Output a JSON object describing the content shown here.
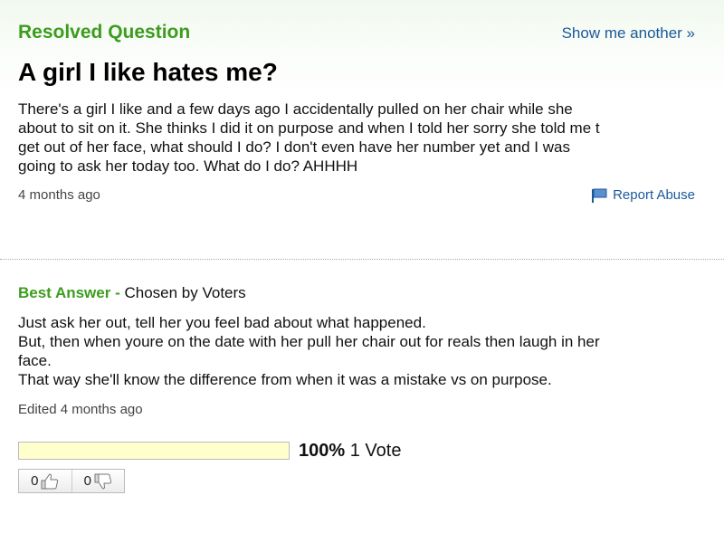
{
  "question": {
    "status_label": "Resolved Question",
    "show_another_label": "Show me another »",
    "title": "A girl I like hates me?",
    "body_lines": [
      "There's a girl I like and a few days ago I accidentally pulled on her chair while she",
      "about to sit on it. She thinks I did it on purpose and when I told her sorry she told me t",
      "get out of her face, what should I do? I don't even have her number yet and I was",
      "going to ask her today too. What do I do? AHHHH"
    ],
    "asked_time": "4 months ago",
    "report_abuse_label": "Report Abuse",
    "report_icon": "flag-icon"
  },
  "best_answer": {
    "label": "Best Answer",
    "separator": " - ",
    "chosen_by": "Chosen by Voters",
    "body_lines": [
      "Just ask her out, tell her you feel bad about what happened.",
      "But, then when youre on the date with her pull her chair out for reals then laugh in her",
      "face.",
      "That way she'll know the difference from when it was a mistake vs on purpose."
    ],
    "edited_time": "Edited 4 months ago"
  },
  "votes": {
    "fill_fraction": 1.0,
    "percent_label": "100%",
    "count_label": "1 Vote"
  },
  "ratings": {
    "thumbs_up_count": "0",
    "thumbs_down_count": "0",
    "thumbs_up_icon": "thumbs-up-icon",
    "thumbs_down_icon": "thumbs-down-icon"
  },
  "colors": {
    "accent_green": "#3c9c1e",
    "link_blue": "#1b5a9a",
    "vote_fill": "#ffffcc"
  }
}
